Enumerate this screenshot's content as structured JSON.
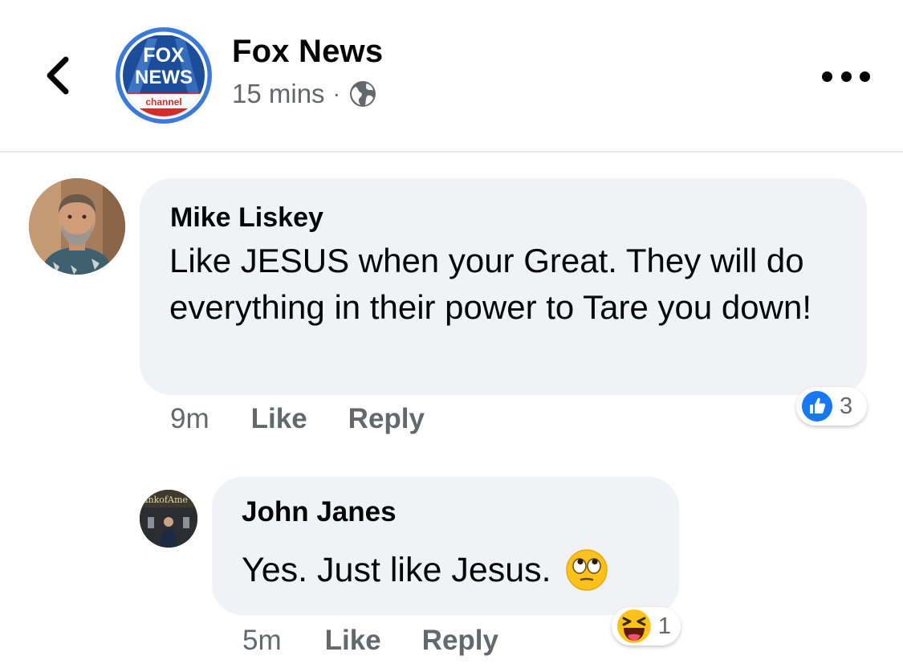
{
  "header": {
    "page_name": "Fox News",
    "time": "15 mins",
    "dot": "·",
    "logo": {
      "line1": "FOX",
      "line2": "NEWS",
      "line3": "channel"
    },
    "audience_icon": "globe-icon",
    "back_icon": "chevron-left-icon",
    "more_icon": "more-horizontal-icon"
  },
  "comments": [
    {
      "author": "Mike Liskey",
      "text": "Like JESUS when your Great. They will do everything in their power to Tare you down!",
      "time": "9m",
      "like_label": "Like",
      "reply_label": "Reply",
      "reaction": {
        "icon": "like-reaction-icon",
        "count": "3"
      }
    },
    {
      "author": "John Janes",
      "text": "Yes. Just like Jesus.",
      "emoji": "eye-roll-emoji",
      "avatar_sign": "ankofAme",
      "time": "5m",
      "like_label": "Like",
      "reply_label": "Reply",
      "reaction": {
        "icon": "haha-reaction-icon",
        "count": "1"
      }
    }
  ],
  "colors": {
    "accent_blue": "#1877f2",
    "logo_red": "#d62b2b",
    "logo_blue": "#1b4d9b",
    "bubble": "#f0f2f5",
    "secondary_text": "#65676b"
  }
}
